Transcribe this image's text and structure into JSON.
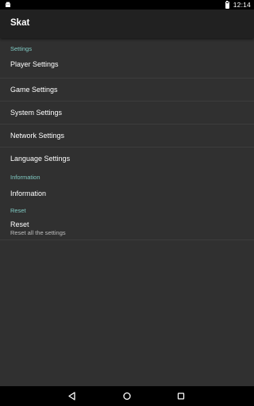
{
  "status_bar": {
    "time": "12:14",
    "icons": [
      "android-debug-icon",
      "battery-icon"
    ]
  },
  "app_bar": {
    "title": "Skat"
  },
  "sections": [
    {
      "header": "Settings",
      "items": [
        {
          "title": "Player Settings"
        },
        {
          "title": "Game Settings"
        },
        {
          "title": "System Settings"
        },
        {
          "title": "Network Settings"
        },
        {
          "title": "Language Settings"
        }
      ]
    },
    {
      "header": "Information",
      "items": [
        {
          "title": "Information"
        }
      ]
    },
    {
      "header": "Reset",
      "items": [
        {
          "title": "Reset",
          "summary": "Reset all the settings"
        }
      ]
    }
  ],
  "nav_bar": {
    "buttons": [
      "back-icon",
      "home-icon",
      "recents-icon"
    ]
  },
  "colors": {
    "background": "#303030",
    "app_bar": "#212121",
    "accent": "#80cbc4",
    "text_primary": "#ffffff",
    "text_secondary": "#bdbdbd",
    "divider": "#3d3d3d"
  }
}
